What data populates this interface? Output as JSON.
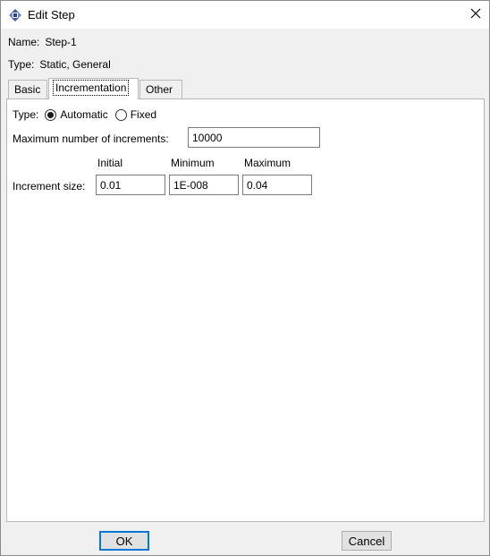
{
  "window": {
    "title": "Edit Step",
    "icon": "abaqus-step-icon",
    "close_icon": "close-icon"
  },
  "info": {
    "name_label": "Name:",
    "name_value": "Step-1",
    "type_label": "Type:",
    "type_value": "Static, General"
  },
  "tabs": [
    {
      "label": "Basic",
      "active": false
    },
    {
      "label": "Incrementation",
      "active": true
    },
    {
      "label": "Other",
      "active": false
    }
  ],
  "incrementation": {
    "type_label": "Type:",
    "type_options": [
      {
        "label": "Automatic",
        "selected": true
      },
      {
        "label": "Fixed",
        "selected": false
      }
    ],
    "max_increments_label": "Maximum number of increments:",
    "max_increments_value": "10000",
    "columns": [
      "Initial",
      "Minimum",
      "Maximum"
    ],
    "increment_size_label": "Increment size:",
    "increment_size_values": [
      "0.01",
      "1E-008",
      "0.04"
    ]
  },
  "buttons": {
    "ok": "OK",
    "cancel": "Cancel"
  },
  "colors": {
    "default_button_border": "#0078d7",
    "panel_background": "#ffffff",
    "dialog_background": "#f0f0f0"
  }
}
